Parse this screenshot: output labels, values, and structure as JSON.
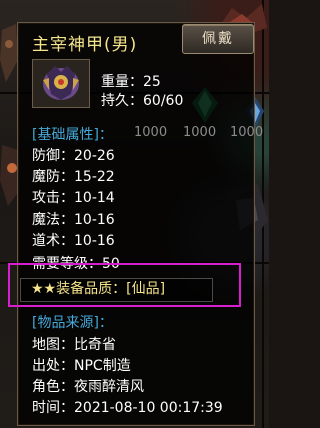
{
  "item": {
    "name": "主宰神甲(男)",
    "equip_label": "佩戴",
    "weight": "重量：25",
    "durability": "持久：60/60"
  },
  "base_section": "[基础属性]：",
  "bg_numbers": [
    "1000",
    "1000",
    "1000"
  ],
  "stats": [
    "防御：20-26",
    "魔防：15-22",
    "攻击：10-14",
    "魔法：10-16",
    "道术：10-16"
  ],
  "requirement": "需要等级：50",
  "quality": "★★装备品质：[仙品]",
  "source_section": "[物品来源]：",
  "source": [
    "地图：比奇省",
    "出处：NPC制造",
    "角色：夜雨醉清风",
    "时间：2021-08-10 00:17:39"
  ],
  "colors": {
    "title": "#f4e48a",
    "section": "#46a8d8",
    "highlight": "#d81fcf"
  }
}
